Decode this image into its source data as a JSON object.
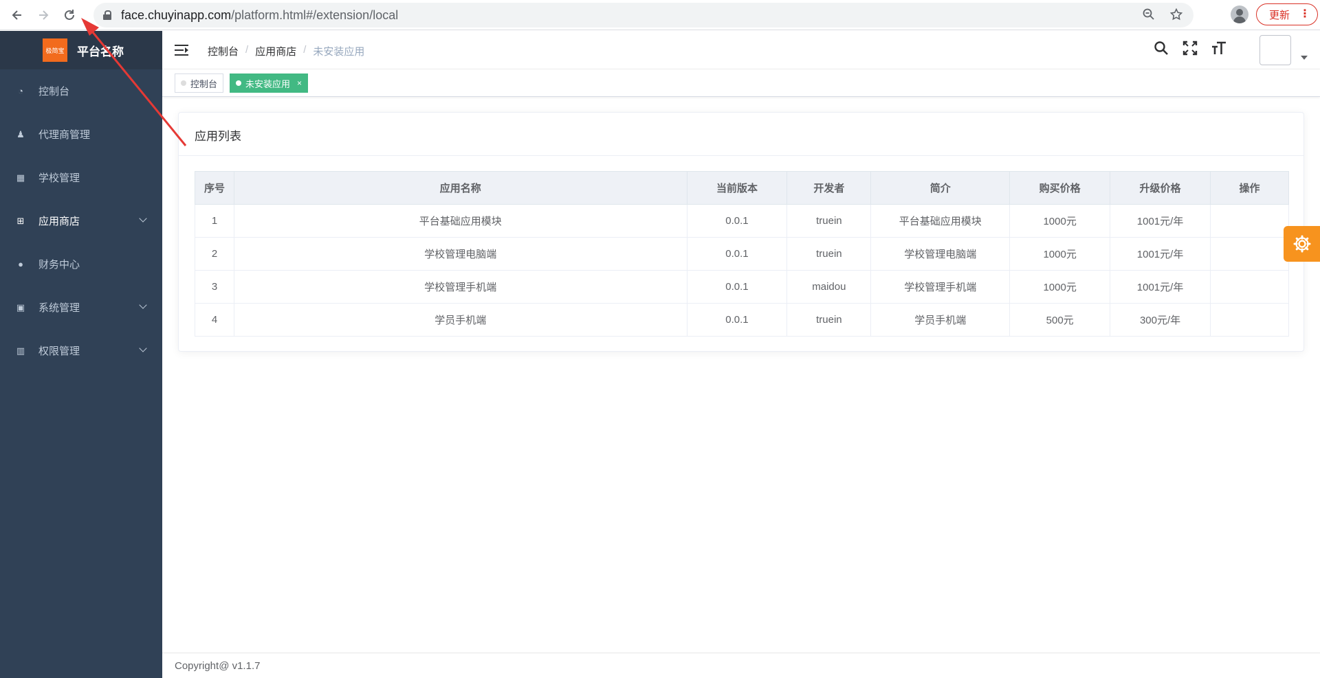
{
  "browser": {
    "url_host": "face.chuyinapp.com",
    "url_path": "/platform.html#/extension/local",
    "update_label": "更新"
  },
  "sidebar": {
    "logo_badge": "极简宝",
    "logo_text": "平台名称",
    "items": [
      {
        "label": "控制台",
        "icon": "dashboard-icon"
      },
      {
        "label": "代理商管理",
        "icon": "user-icon"
      },
      {
        "label": "学校管理",
        "icon": "building-icon"
      },
      {
        "label": "应用商店",
        "icon": "windows-icon",
        "expandable": true
      },
      {
        "label": "财务中心",
        "icon": "money-icon"
      },
      {
        "label": "系统管理",
        "icon": "settings-box-icon",
        "expandable": true
      },
      {
        "label": "权限管理",
        "icon": "chart-icon",
        "expandable": true
      }
    ]
  },
  "header": {
    "breadcrumb": [
      "控制台",
      "应用商店",
      "未安装应用"
    ]
  },
  "tags": [
    {
      "label": "控制台",
      "active": false
    },
    {
      "label": "未安装应用",
      "active": true,
      "close": "×"
    }
  ],
  "card": {
    "title": "应用列表",
    "columns": [
      "序号",
      "应用名称",
      "当前版本",
      "开发者",
      "简介",
      "购买价格",
      "升级价格",
      "操作"
    ],
    "rows": [
      [
        "1",
        "平台基础应用模块",
        "0.0.1",
        "truein",
        "平台基础应用模块",
        "1000元",
        "1001元/年",
        ""
      ],
      [
        "2",
        "学校管理电脑端",
        "0.0.1",
        "truein",
        "学校管理电脑端",
        "1000元",
        "1001元/年",
        ""
      ],
      [
        "3",
        "学校管理手机端",
        "0.0.1",
        "maidou",
        "学校管理手机端",
        "1000元",
        "1001元/年",
        ""
      ],
      [
        "4",
        "学员手机端",
        "0.0.1",
        "truein",
        "学员手机端",
        "500元",
        "300元/年",
        ""
      ]
    ]
  },
  "footer": {
    "text": "Copyright@ v1.1.7"
  },
  "colors": {
    "sidebar_bg": "#304156",
    "tag_active": "#42b983",
    "fab": "#f7931e",
    "annotation_arrow": "#e53935"
  }
}
